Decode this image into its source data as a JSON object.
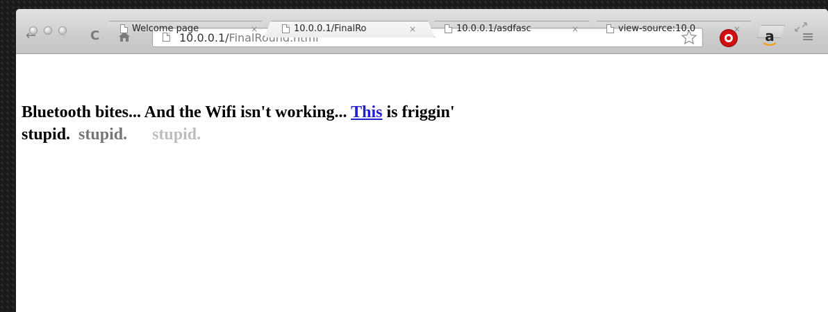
{
  "tabs": [
    {
      "title": "Welcome page",
      "close": "×",
      "active": false
    },
    {
      "title": "10.0.0.1/FinalRo",
      "close": "×",
      "active": true
    },
    {
      "title": "10.0.0.1/asdfasc",
      "close": "×",
      "active": false
    },
    {
      "title": "view-source:10.0",
      "close": "×",
      "active": false
    }
  ],
  "toolbar": {
    "back_icon": "←",
    "forward_icon": "→",
    "reload_icon": "C",
    "home_icon": "home-icon",
    "url_host": "10.0.0.1/",
    "url_path": "FinalRound.html",
    "menu_icon": "≡",
    "amazon_label": "a"
  },
  "page": {
    "line1_start": "Bluetooth bites... And the Wifi isn't working...",
    "link_text": "This",
    "line1_end": "is friggin'",
    "word1": "stupid.",
    "word2": "stupid.",
    "word3": "stupid."
  },
  "colors": {
    "link": "#2020d0",
    "stupid_gray": "#767676",
    "stupid_light": "#bdbdbd"
  }
}
